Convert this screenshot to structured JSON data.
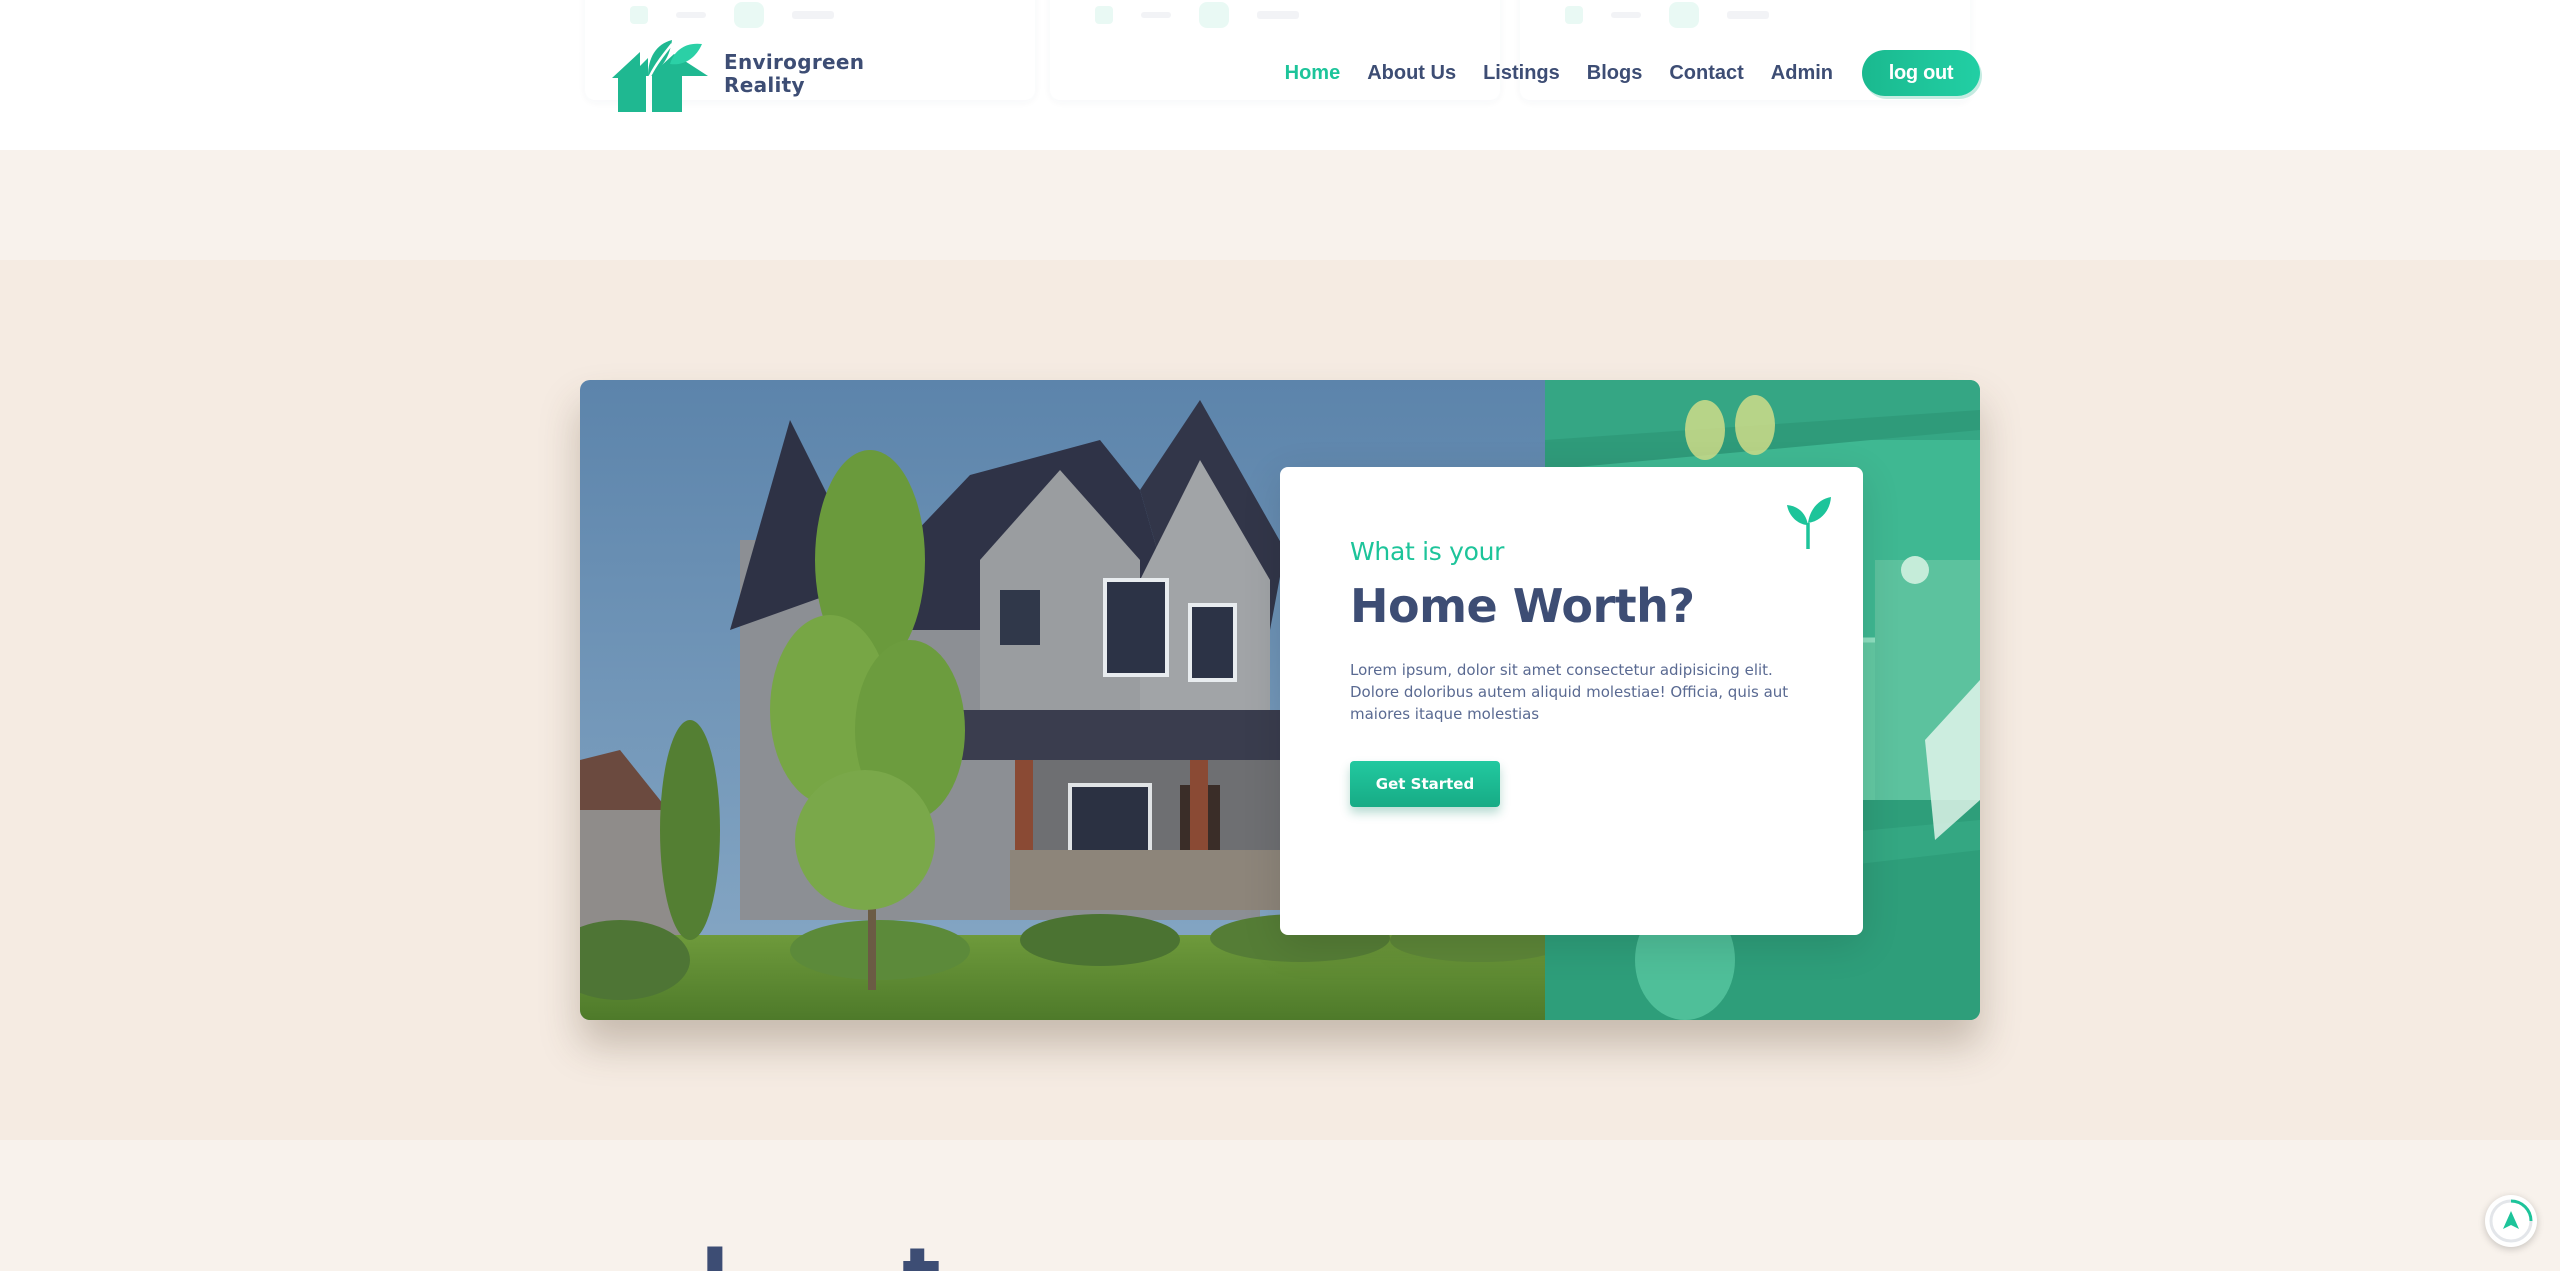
{
  "header": {
    "brand": {
      "line1": "Envirogreen",
      "line2": "Reality"
    },
    "nav": {
      "home": "Home",
      "about": "About Us",
      "listings": "Listings",
      "blogs": "Blogs",
      "contact": "Contact",
      "admin": "Admin",
      "active": "home"
    },
    "logout_label": "log out"
  },
  "hero": {
    "eyebrow": "What is your",
    "title": "Home Worth?",
    "description": "Lorem ipsum, dolor sit amet consectetur adipisicing elit. Dolore doloribus autem aliquid molestiae! Officia, quis aut maiores itaque molestias",
    "cta_label": "Get Started"
  },
  "next_section": {
    "heading_fragment": "L     t"
  },
  "icons": {
    "logo": "house-leaf-icon",
    "card": "sprout-icon",
    "scroll": "arrow-up-icon"
  },
  "colors": {
    "accent": "#1dc49a",
    "navy": "#3d4d74",
    "background": "#f5ebe2"
  }
}
